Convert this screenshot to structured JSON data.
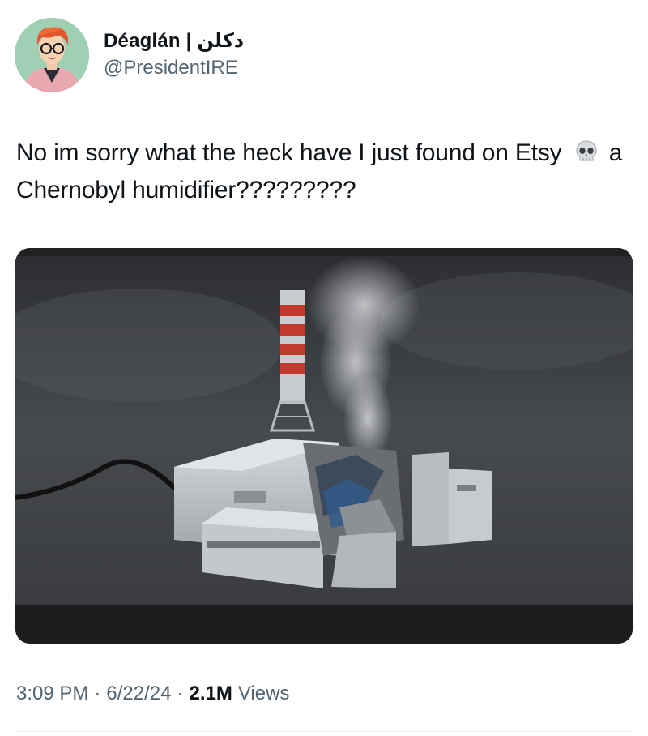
{
  "author": {
    "display_name": "Déaglán | دكلن",
    "handle": "@PresidentIRE"
  },
  "tweet": {
    "text_before_emoji": "No im sorry what the heck have I just found on Etsy",
    "emoji": "skull-icon",
    "text_after_emoji": "a Chernobyl humidifier?????????"
  },
  "media": {
    "kind": "photo",
    "subject": "3D-printed Chernobyl reactor model humidifier with steam rising from the damaged reactor"
  },
  "meta": {
    "time": "3:09 PM",
    "separator": "·",
    "date": "6/22/24",
    "views_count": "2.1M",
    "views_label": "Views"
  },
  "colors": {
    "text": "#0f1419",
    "secondary": "#536471",
    "divider": "#eff3f4"
  }
}
